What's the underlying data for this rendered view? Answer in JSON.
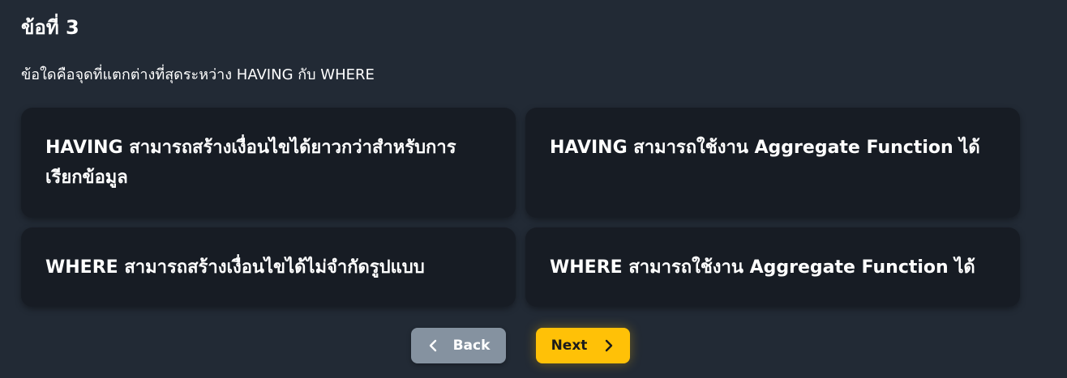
{
  "quiz": {
    "title": "ข้อที่ 3",
    "question": "ข้อใดคือจุดที่แตกต่างที่สุดระหว่าง HAVING กับ WHERE",
    "choices": [
      "HAVING สามารถสร้างเงื่อนไขได้ยาวกว่าสำหรับการเรียกข้อมูล",
      "HAVING สามารถใช้งาน Aggregate Function ได้",
      "WHERE สามารถสร้างเงื่อนไขได้ไม่จำกัดรูปแบบ",
      "WHERE สามารถใช้งาน Aggregate Function ได้"
    ]
  },
  "nav": {
    "back_label": "Back",
    "next_label": "Next",
    "back_icon": "chevron-left-icon",
    "next_icon": "chevron-right-icon"
  },
  "colors": {
    "background": "#222a35",
    "card": "#171c24",
    "back_button": "#8592a0",
    "next_button": "#ffc107"
  }
}
